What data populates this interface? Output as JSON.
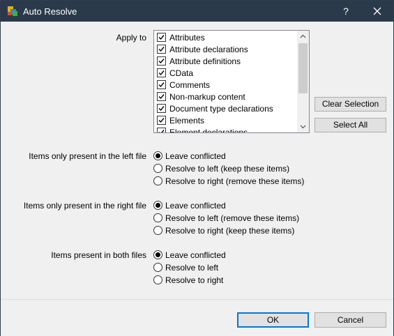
{
  "window": {
    "title": "Auto Resolve",
    "help_label": "?"
  },
  "apply_to": {
    "label": "Apply to",
    "items": [
      {
        "label": "Attributes",
        "checked": true
      },
      {
        "label": "Attribute declarations",
        "checked": true
      },
      {
        "label": "Attribute definitions",
        "checked": true
      },
      {
        "label": "CData",
        "checked": true
      },
      {
        "label": "Comments",
        "checked": true
      },
      {
        "label": "Non-markup content",
        "checked": true
      },
      {
        "label": "Document type declarations",
        "checked": true
      },
      {
        "label": "Elements",
        "checked": true
      },
      {
        "label": "Element declarations",
        "checked": true
      }
    ],
    "clear_selection_label": "Clear Selection",
    "select_all_label": "Select All"
  },
  "groups": [
    {
      "label": "Items only present in the left file",
      "options": [
        "Leave conflicted",
        "Resolve to left (keep these items)",
        "Resolve to right (remove these items)"
      ],
      "selected": "Leave conflicted"
    },
    {
      "label": "Items only present in the right file",
      "options": [
        "Leave conflicted",
        "Resolve to left (remove these items)",
        "Resolve to right (keep these items)"
      ],
      "selected": "Leave conflicted"
    },
    {
      "label": "Items present in both files",
      "options": [
        "Leave conflicted",
        "Resolve to left",
        "Resolve to right"
      ],
      "selected": "Leave conflicted"
    }
  ],
  "footer": {
    "ok_label": "OK",
    "cancel_label": "Cancel"
  },
  "colors": {
    "titlebar": "#2b3a4b",
    "accent": "#0078d7",
    "panel": "#f0f0f0"
  }
}
